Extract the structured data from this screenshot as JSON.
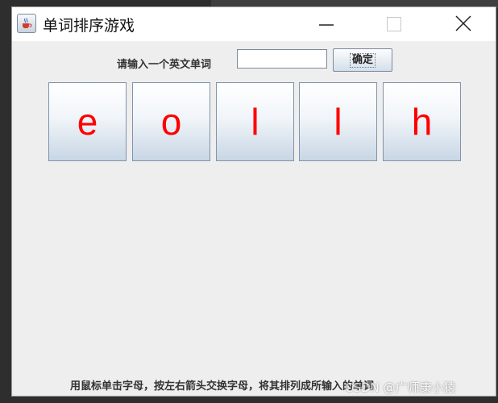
{
  "window": {
    "title": "单词排序游戏"
  },
  "form": {
    "prompt_label": "请输入一个英文单词",
    "word_value": "",
    "confirm_label": "确定"
  },
  "tiles": [
    "e",
    "o",
    "l",
    "l",
    "h"
  ],
  "footer": {
    "hint": "用鼠标单击字母，按左右箭头交换字母，将其排列成所输入的单词"
  },
  "watermark": "CSDN @广师康小猿",
  "colors": {
    "letter": "#ff0000",
    "titlebar": "#ffffff",
    "client": "#eeeeee"
  },
  "icons": {
    "app": "java-coffee-icon",
    "minimize": "minimize-icon",
    "maximize": "maximize-icon",
    "close": "close-icon"
  }
}
